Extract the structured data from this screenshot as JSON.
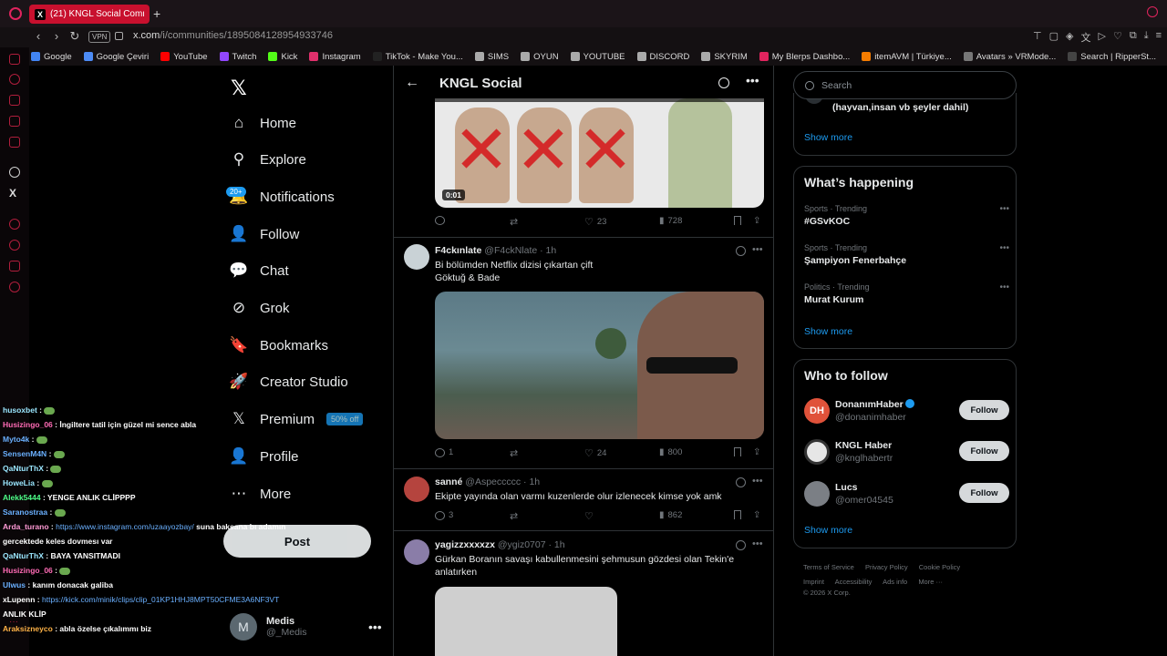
{
  "browser": {
    "tab_title": "(21) KNGL Social Commu",
    "tab_favicon": "X",
    "new_tab": "+",
    "vpn_label": "VPN",
    "url_host": "x.com",
    "url_path": "/i/communities/1895084128954933746",
    "bookmarks": [
      {
        "label": "Google",
        "color": "#4285f4"
      },
      {
        "label": "Google Çeviri",
        "color": "#4c8bf5"
      },
      {
        "label": "YouTube",
        "color": "#ff0000"
      },
      {
        "label": "Twitch",
        "color": "#9146ff"
      },
      {
        "label": "Kick",
        "color": "#53fc18"
      },
      {
        "label": "Instagram",
        "color": "#e1306c"
      },
      {
        "label": "TikTok - Make You...",
        "color": "#222222"
      },
      {
        "label": "SIMS",
        "color": "#aaaaaa"
      },
      {
        "label": "OYUN",
        "color": "#aaaaaa"
      },
      {
        "label": "YOUTUBE",
        "color": "#aaaaaa"
      },
      {
        "label": "DISCORD",
        "color": "#aaaaaa"
      },
      {
        "label": "SKYRIM",
        "color": "#aaaaaa"
      },
      {
        "label": "My Blerps Dashbo...",
        "color": "#e0245e"
      },
      {
        "label": "itemAVM | Türkiye...",
        "color": "#f57c00"
      },
      {
        "label": "Avatars » VRMode...",
        "color": "#777777"
      },
      {
        "label": "Search | RipperSt...",
        "color": "#444444"
      }
    ]
  },
  "nav": {
    "items": [
      {
        "label": "Home",
        "icon": "home-icon",
        "glyph": "⌂"
      },
      {
        "label": "Explore",
        "icon": "search-icon",
        "glyph": "⚲"
      },
      {
        "label": "Notifications",
        "icon": "bell-icon",
        "glyph": "🔔"
      },
      {
        "label": "Follow",
        "icon": "add-person-icon",
        "glyph": "👤"
      },
      {
        "label": "Chat",
        "icon": "chat-icon",
        "glyph": "💬"
      },
      {
        "label": "Grok",
        "icon": "grok-icon",
        "glyph": "⊘"
      },
      {
        "label": "Bookmarks",
        "icon": "bookmark-icon",
        "glyph": "🔖"
      },
      {
        "label": "Creator Studio",
        "icon": "rocket-icon",
        "glyph": "🚀"
      },
      {
        "label": "Premium",
        "icon": "x-premium-icon",
        "glyph": "𝕏"
      },
      {
        "label": "Profile",
        "icon": "person-icon",
        "glyph": "👤"
      },
      {
        "label": "More",
        "icon": "more-circle-icon",
        "glyph": "⋯"
      }
    ],
    "notif_badge": "20+",
    "premium_badge": "50% off",
    "post_label": "Post",
    "account": {
      "initial": "M",
      "name": "Medis",
      "handle": "@_Medis"
    }
  },
  "chat": [
    {
      "user": "husoxbet",
      "color": "#9be7ff",
      "text": ":",
      "emote": true
    },
    {
      "user": "Husizingo_06",
      "color": "#ff6bb5",
      "text": ": İngiltere tatil için güzel mi sence abla"
    },
    {
      "user": "Myto4k",
      "color": "#6ab0ff",
      "text": ":",
      "emote": true
    },
    {
      "user": "SensenM4N",
      "color": "#6ab0ff",
      "text": ":",
      "emote": true
    },
    {
      "user": "QaNturThX",
      "color": "#9be7ff",
      "text": ":",
      "emote": true
    },
    {
      "user": "HoweLia",
      "color": "#9be7ff",
      "text": ":",
      "emote": true
    },
    {
      "user": "Alekk5444",
      "color": "#4dff88",
      "text": ": YENGE ANLIK CLİPPPP"
    },
    {
      "user": "Saranostraa",
      "color": "#6ab0ff",
      "text": ":",
      "emote": true
    },
    {
      "user": "Arda_turano",
      "color": "#ff9ad5",
      "text": ":",
      "link": "https://www.instagram.com/uzaayozbay/",
      "after": "suna baksana bı adamın"
    },
    {
      "user": "",
      "color": "#ffffff",
      "text": "gercektede keles dovmesı var"
    },
    {
      "user": "QaNturThX",
      "color": "#9be7ff",
      "text": ": BAYA YANSITMADI"
    },
    {
      "user": "Husizingo_06",
      "color": "#ff6bb5",
      "text": ":",
      "emote": true
    },
    {
      "user": "Ulwus",
      "color": "#6ab0ff",
      "text": ": kanım donacak galiba"
    },
    {
      "user": "xLupenn",
      "color": "#ffffff",
      "text": ":",
      "link": "https://kick.com/minik/clips/clip_01KP1HHJ8MPT50CFME3A6NF3VT",
      "after": ""
    },
    {
      "user": "",
      "color": "#ffffff",
      "text": "ANLIK KLİP"
    },
    {
      "user": "Araksizneyco",
      "color": "#ffb347",
      "text": ": abla özelse çıkalımmı biz"
    }
  ],
  "community": {
    "title": "KNGL Social",
    "tweet0": {
      "duration": "0:01",
      "likes": "23",
      "views": "728"
    },
    "tweets": [
      {
        "name": "F4ckınlate",
        "handle": "@F4ckNlate",
        "time": "· 1h",
        "text": "Bi bölümden Netflix dizisi çıkartan çift\nGöktuğ & Bade",
        "replies": "1",
        "likes": "24",
        "views": "800"
      },
      {
        "name": "sanné",
        "handle": "@Aspeccccc",
        "time": "· 1h",
        "text": "Ekipte yayında olan varmı kuzenlerde olur izlenecek kimse yok amk",
        "replies": "3",
        "likes": "",
        "views": "862"
      },
      {
        "name": "yagizzxxxxzx",
        "handle": "@ygiz0707",
        "time": "· 1h",
        "text": "Gürkan Boranın savaşı kabullenmesini şehmusun gözdesi olan Tekin'e anlatırken"
      }
    ]
  },
  "right": {
    "search_placeholder": "Search",
    "snippet": "(hayvan,insan vb şeyler dahil)",
    "show_more": "Show more",
    "happening_title": "What’s happening",
    "trends": [
      {
        "meta": "Sports · Trending",
        "name": "#GSvKOC"
      },
      {
        "meta": "Sports · Trending",
        "name": "Şampiyon Fenerbahçe"
      },
      {
        "meta": "Politics · Trending",
        "name": "Murat Kurum"
      }
    ],
    "wtf_title": "Who to follow",
    "follow_label": "Follow",
    "who_to_follow": [
      {
        "name": "DonanımHaber",
        "handle": "@donanimhaber",
        "verified": true,
        "color": "#e0523a",
        "initials": "DH"
      },
      {
        "name": "KNGL Haber",
        "handle": "@knglhabertr",
        "verified": false,
        "color": "#dddddd",
        "initials": ""
      },
      {
        "name": "Lucs",
        "handle": "@omer04545",
        "verified": false,
        "color": "#7b7f85",
        "initials": ""
      }
    ],
    "footer_links": [
      "Terms of Service",
      "Privacy Policy",
      "Cookie Policy",
      "Imprint",
      "Accessibility",
      "Ads info",
      "More ···"
    ],
    "copyright": "© 2026 X Corp."
  }
}
